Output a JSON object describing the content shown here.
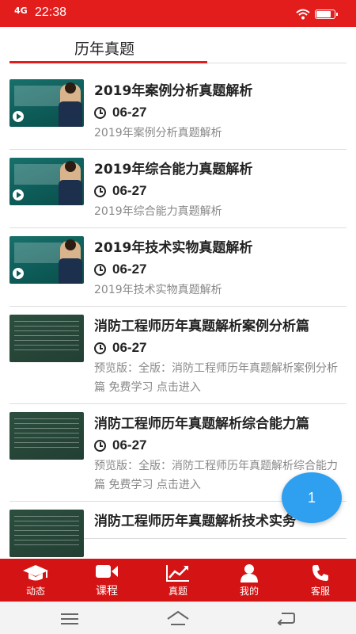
{
  "status_bar": {
    "network": "4G",
    "time": "22:38"
  },
  "tab": {
    "label": "历年真题"
  },
  "items": [
    {
      "thumb": "video",
      "title": "2019年案例分析真题解析",
      "date": "06-27",
      "desc": "2019年案例分析真题解析"
    },
    {
      "thumb": "video",
      "title": "2019年综合能力真题解析",
      "date": "06-27",
      "desc": "2019年综合能力真题解析"
    },
    {
      "thumb": "video",
      "title": "2019年技术实物真题解析",
      "date": "06-27",
      "desc": "2019年技术实物真题解析"
    },
    {
      "thumb": "board",
      "title": "消防工程师历年真题解析案例分析篇",
      "date": "06-27",
      "desc": "预览版：全版：消防工程师历年真题解析案例分析篇 免费学习 点击进入"
    },
    {
      "thumb": "board",
      "title": "消防工程师历年真题解析综合能力篇",
      "date": "06-27",
      "desc": "预览版：全版：消防工程师历年真题解析综合能力篇 免费学习 点击进入"
    },
    {
      "thumb": "board",
      "title": "消防工程师历年真题解析技术实务",
      "date": "",
      "desc": ""
    }
  ],
  "fab": {
    "label": "1"
  },
  "bottom_nav": [
    {
      "label": "动态",
      "icon": "graduation-cap-icon"
    },
    {
      "label": "课程",
      "icon": "video-camera-icon"
    },
    {
      "label": "真题",
      "icon": "trend-chart-icon"
    },
    {
      "label": "我的",
      "icon": "person-icon"
    },
    {
      "label": "客服",
      "icon": "phone-icon"
    }
  ],
  "system_nav": {
    "icons": [
      "menu-icon",
      "home-icon",
      "back-icon"
    ]
  }
}
